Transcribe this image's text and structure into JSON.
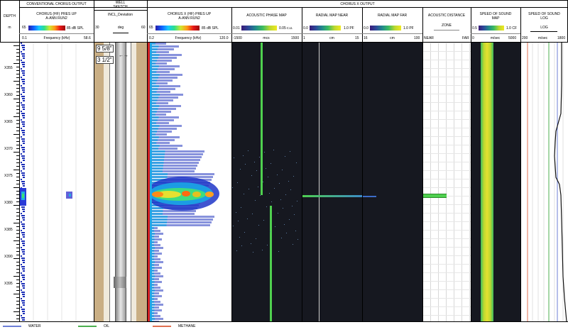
{
  "header": {
    "depth": {
      "title": "DEPTH",
      "unit": "m"
    },
    "conventional_chorus": {
      "group_title": "CONVENTIONAL CHORUS OUTPUT",
      "track_title_1": "CHORUS (HF) PRES UP",
      "track_title_2": "A-ANN RUN2",
      "scale_min": "65",
      "scale_max": "85 dB SPL",
      "axis_min": "0.1",
      "axis_label": "Frequency (kHz)",
      "axis_max": "58.6"
    },
    "well_sketch": {
      "group_title_1": "WELL",
      "group_title_2": "SKETCH",
      "track_title": "INCL_Deviation",
      "axis_min": "30",
      "axis_label": "deg",
      "axis_max": "60",
      "casing_outer": "9 5/8\"",
      "casing_inner": "3 1/2\""
    },
    "chorus_x": {
      "group_title": "CHORUS X OUTPUT",
      "spectrum": {
        "title_1": "CHORUS X (HF) PRES UP",
        "title_2": "A-ANN RUN2",
        "scale_min": "65",
        "scale_max": "85 dB SPL",
        "axis_min": "0.2",
        "axis_label": "Frequency (kHz)",
        "axis_max": "120.0"
      },
      "phase_map": {
        "title": "ACOUSTIC PHASE MAP",
        "scale_min": "0.01",
        "scale_max": "0.05 c.u.",
        "axis_min": "-1500",
        "axis_label": "mcs",
        "axis_max": "1500"
      },
      "radial_near": {
        "title": "RADIAL MAP NEAR",
        "scale_min": "0.0",
        "scale_max": "1.0 PF",
        "axis_min": "1",
        "axis_label": "cm",
        "axis_max": "15"
      },
      "radial_far": {
        "title": "RADIAL MAP FAR",
        "scale_min": "0.0",
        "scale_max": "1.0 PF",
        "axis_min": "16",
        "axis_label": "cm",
        "axis_max": "100"
      },
      "acoustic_distance": {
        "title": "ACOUSTIC DISTANCE",
        "subtitle": "ZONE",
        "near": "NEAR",
        "far": "FAR"
      },
      "speed_map": {
        "title_1": "SPEED OF SOUND",
        "title_2": "MAP",
        "scale_min": "0.5",
        "scale_max": "1.0 CF",
        "axis_min": "0",
        "axis_label": "m/sec",
        "axis_max": "5000"
      },
      "speed_log": {
        "title_1": "SPEED OF SOUND",
        "title_2": "LOG",
        "subtitle": "LOG",
        "axis_min": "200",
        "axis_label": "m/sec",
        "axis_max": "1800"
      }
    }
  },
  "depth_labels": [
    "X355",
    "X360",
    "X365",
    "X370",
    "X375",
    "X380",
    "X385",
    "X390",
    "X395"
  ],
  "legend": [
    {
      "label": "WATER",
      "color": "#6d7fd6"
    },
    {
      "label": "OIL",
      "color": "#4caf50"
    },
    {
      "label": "METHANE",
      "color": "#e07050"
    }
  ],
  "colors": {
    "dark_track": "#161820",
    "sand": "#c9ae84",
    "pipe": "#b8b8b8",
    "green_line": "#4fd04f",
    "yellow": "#e6e030"
  }
}
